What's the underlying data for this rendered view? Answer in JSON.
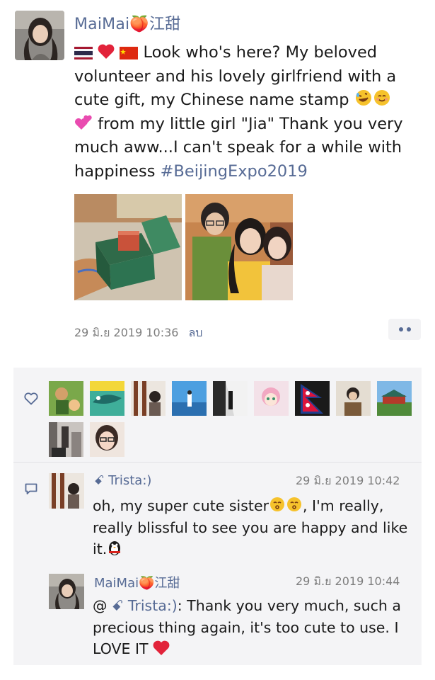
{
  "post": {
    "author": "MaiMai🍑江甜",
    "text_lines": [
      " Look who's here? My beloved",
      "volunteer and his lovely girlfriend with a",
      "cute gift, my Chinese name stamp ",
      " from my little girl \"Jia\" Thank you very",
      "much aww...I can't speak for a while with",
      "happiness "
    ],
    "hashtag": "#BeijingExpo2019",
    "timestamp": "29 มิ.ย 2019 10:36",
    "delete_label": "ลบ"
  },
  "likes": {
    "icon": "heart-outline-icon",
    "count_shown": 11
  },
  "comments": [
    {
      "name": "ꗃ Trista:)",
      "time": "29 มิ.ย 2019 10:42",
      "text_lines": [
        "oh, my super cute sister",
        "really blissful to see  you are happy and like",
        "it."
      ],
      "line1_tail": ", I'm really,"
    },
    {
      "name": "MaiMai🍑江甜",
      "time": "29 มิ.ย 2019 10:44",
      "reply_prefix": "@ ",
      "reply_to": "ꗃ Trista:)",
      "text_lines": [
        ": Thank you very much, such a",
        "precious thing again, it's too cute to use. I",
        "LOVE IT "
      ]
    }
  ],
  "colors": {
    "link": "#576b95",
    "panel": "#f4f4f6",
    "meta": "#7d7d7d"
  }
}
